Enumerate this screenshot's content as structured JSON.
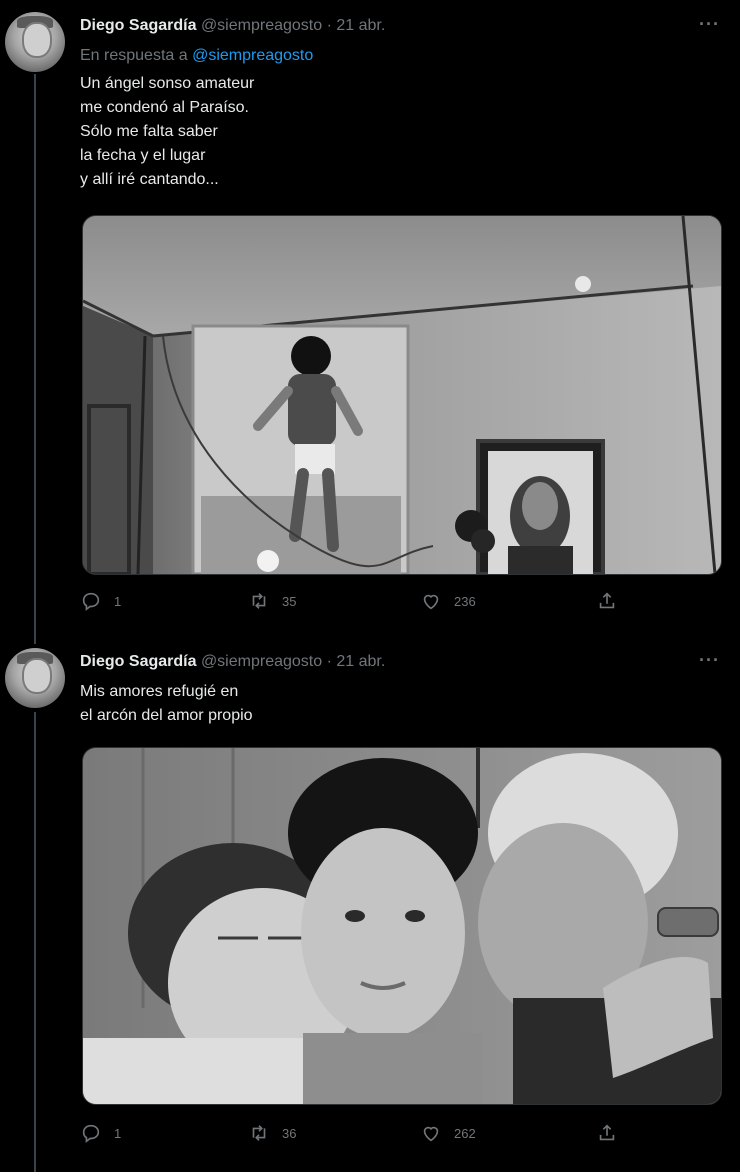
{
  "tweets": [
    {
      "name": "Diego Sagardía",
      "handle": "@siempreagosto",
      "separator": "·",
      "date": "21 abr.",
      "more": "···",
      "reply_prefix": "En respuesta a",
      "reply_handle": "@siempreagosto",
      "lines": [
        "Un ángel sonso amateur",
        "me condenó al Paraíso.",
        "Sólo me falta saber",
        "la fecha y el lugar",
        "y allí iré cantando..."
      ],
      "stats": {
        "replies": "1",
        "retweets": "35",
        "likes": "236"
      }
    },
    {
      "name": "Diego Sagardía",
      "handle": "@siempreagosto",
      "separator": "·",
      "date": "21 abr.",
      "more": "···",
      "lines": [
        "Mis amores refugié en",
        "el arcón del amor propio"
      ],
      "stats": {
        "replies": "1",
        "retweets": "36",
        "likes": "262"
      }
    }
  ],
  "icons": [
    "reply-icon",
    "retweet-icon",
    "like-icon",
    "share-icon",
    "more-icon"
  ],
  "colors": {
    "background": "#000000",
    "text": "#e7e9ea",
    "muted": "#71767b",
    "link": "#1d9bf0"
  }
}
